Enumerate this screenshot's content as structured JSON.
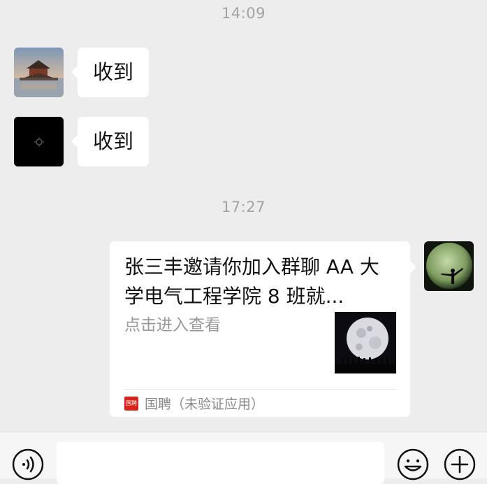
{
  "timestamps": [
    "14:09",
    "17:27"
  ],
  "messages": [
    {
      "sender": "other",
      "avatar": "palace-landscape-avatar",
      "text": "收到"
    },
    {
      "sender": "other",
      "avatar": "dark-avatar",
      "text": "收到"
    }
  ],
  "invite_card": {
    "title": "张三丰邀请你加入群聊 AA 大学电气工程学院 8 班就...",
    "description": "点击进入查看",
    "thumbnail": "moon-thumbnail",
    "app_logo_text": "国聘",
    "app_name": "国聘（未验证应用）"
  },
  "toolbar": {
    "voice_icon": "voice-icon",
    "emoji_icon": "emoji-icon",
    "plus_icon": "plus-icon",
    "input_value": ""
  }
}
